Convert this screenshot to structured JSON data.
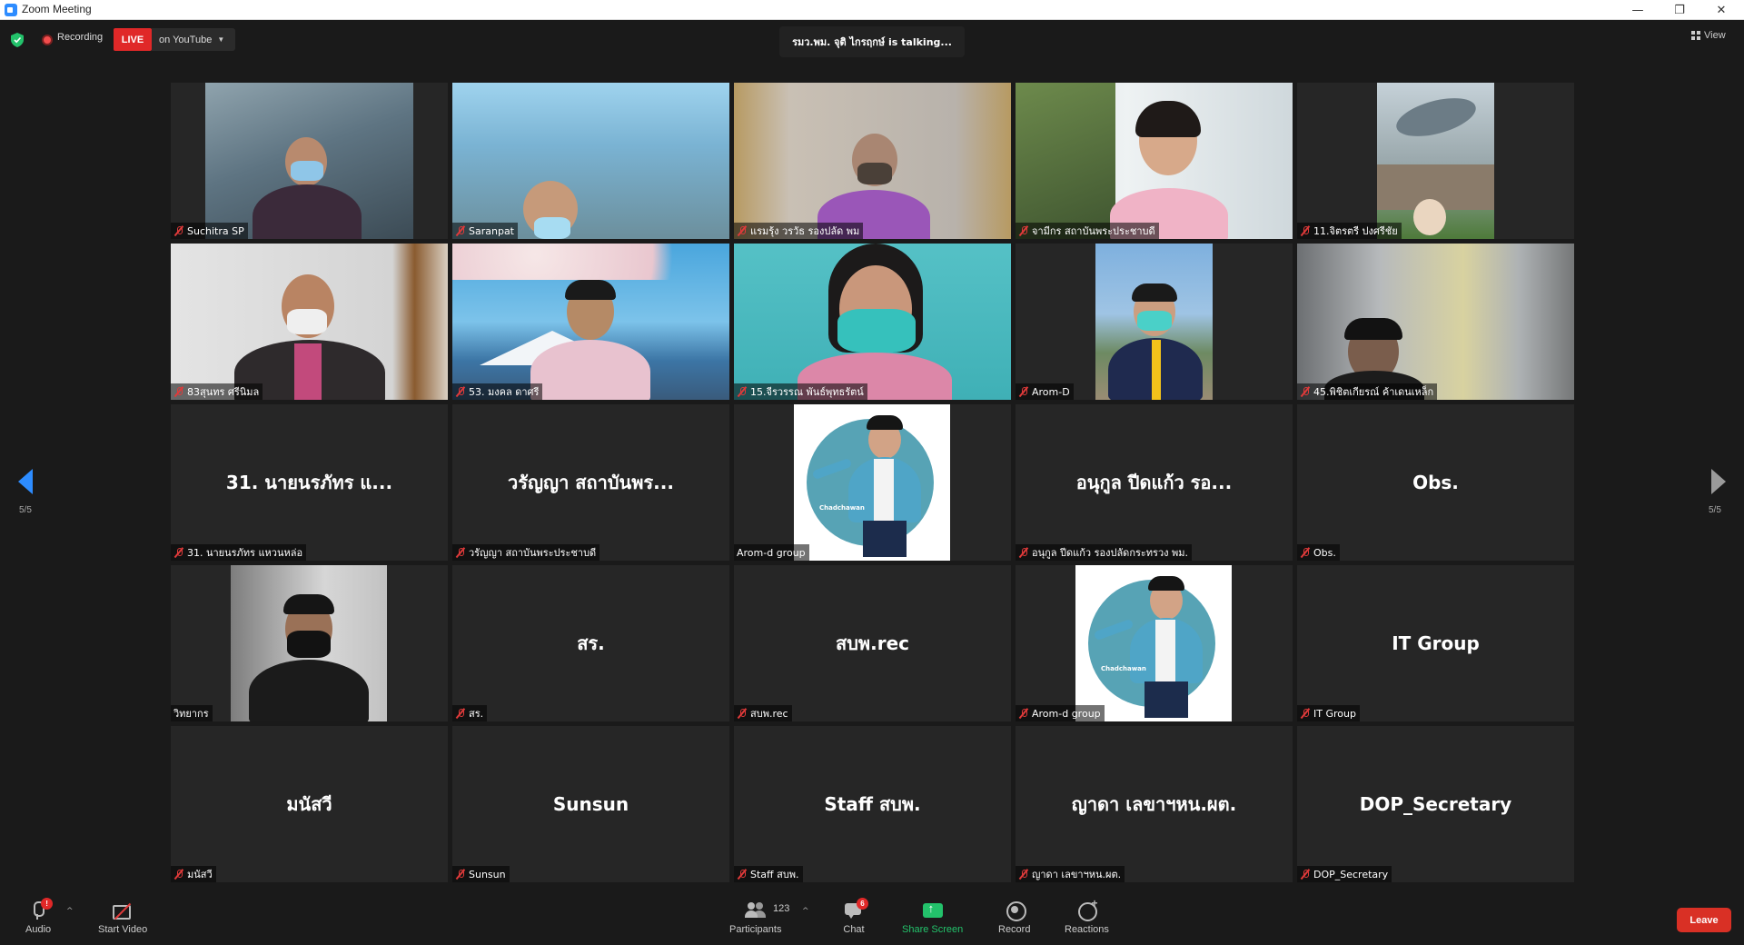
{
  "window": {
    "title": "Zoom Meeting",
    "minimize": "—",
    "maximize": "❐",
    "close": "✕"
  },
  "topbar": {
    "recording_label": "Recording",
    "live_label": "LIVE",
    "stream_target": "on YouTube",
    "talking_text": "รมว.พม. จุติ ไกรฤกษ์ is talking...",
    "view_label": "View"
  },
  "pagination": {
    "left_page": "5/5",
    "right_page": "5/5"
  },
  "tiles": [
    {
      "name": "Suchitra SP",
      "muted": true,
      "big": ""
    },
    {
      "name": "Saranpat",
      "muted": true,
      "big": ""
    },
    {
      "name": "แรมรุ้ง วรวัธ รองปลัด พม",
      "muted": true,
      "big": ""
    },
    {
      "name": "จามีกร สถาบันพระประชาบดี",
      "muted": true,
      "big": ""
    },
    {
      "name": "11.จิตรตรี ปงศรีชัย",
      "muted": true,
      "big": ""
    },
    {
      "name": "83สุนทร ศรีนิมล",
      "muted": true,
      "big": ""
    },
    {
      "name": "53. มงคล ดาศรี",
      "muted": true,
      "big": ""
    },
    {
      "name": "15.จีรวรรณ พันธ์พุทธรัตน์",
      "muted": true,
      "big": ""
    },
    {
      "name": "Arom-D",
      "muted": true,
      "big": ""
    },
    {
      "name": "45.พิชิตเกียรณ์ ค้าเดนเหล็ก",
      "muted": true,
      "big": ""
    },
    {
      "name": "31. นายนรภัทร แหวนหล่อ",
      "muted": true,
      "big": "31. นายนรภัทร แ..."
    },
    {
      "name": "วรัญญา สถาบันพระประชาบดี",
      "muted": true,
      "big": "วรัญญา สถาบันพร..."
    },
    {
      "name": "Arom-d group",
      "muted": false,
      "big": "",
      "logo_text": "Chadchawan"
    },
    {
      "name": "อนุกูล ปีดแก้ว รองปลัดกระทรวง พม.",
      "muted": true,
      "big": "อนุกูล ปีดแก้ว  รอ..."
    },
    {
      "name": "Obs.",
      "muted": true,
      "big": "Obs."
    },
    {
      "name": "วิทยากร",
      "muted": false,
      "big": ""
    },
    {
      "name": "สร.",
      "muted": true,
      "big": "สร."
    },
    {
      "name": "สบพ.rec",
      "muted": true,
      "big": "สบพ.rec"
    },
    {
      "name": "Arom-d group",
      "muted": true,
      "big": "",
      "logo_text": "Chadchawan"
    },
    {
      "name": "IT Group",
      "muted": true,
      "big": "IT Group"
    },
    {
      "name": "มนัสวี",
      "muted": true,
      "big": "มนัสวี"
    },
    {
      "name": "Sunsun",
      "muted": true,
      "big": "Sunsun"
    },
    {
      "name": "Staff สบพ.",
      "muted": true,
      "big": "Staff สบพ."
    },
    {
      "name": "ญาดา เลขาฯหน.ผต.",
      "muted": true,
      "big": "ญาดา เลขาฯหน.ผต."
    },
    {
      "name": "DOP_Secretary",
      "muted": true,
      "big": "DOP_Secretary"
    }
  ],
  "toolbar": {
    "audio_label": "Audio",
    "audio_badge": "!",
    "video_label": "Start Video",
    "participants_label": "Participants",
    "participants_count": "123",
    "chat_label": "Chat",
    "chat_badge": "6",
    "share_label": "Share Screen",
    "record_label": "Record",
    "reactions_label": "Reactions",
    "leave_label": "Leave",
    "caret": "^"
  },
  "colors": {
    "accent": "#2d8cff",
    "live": "#e02828",
    "share": "#23c26b",
    "leave": "#d93025"
  }
}
